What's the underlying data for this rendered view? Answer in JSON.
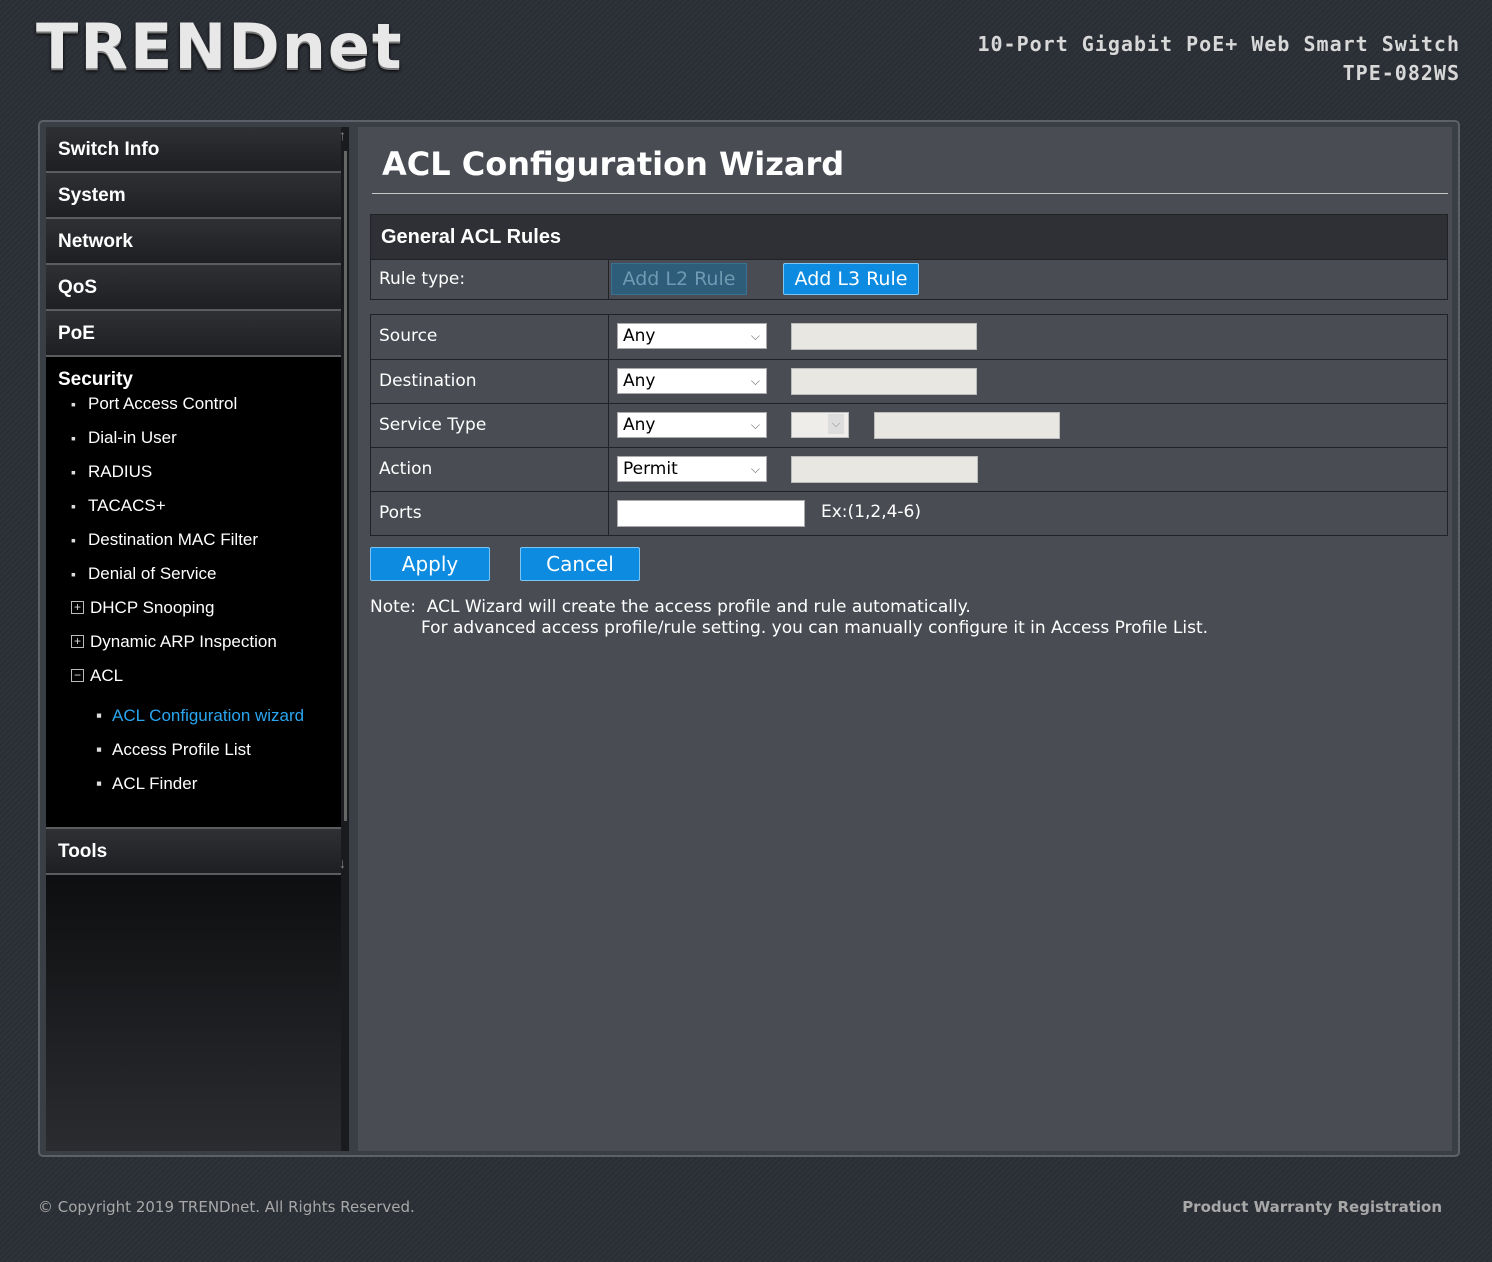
{
  "header": {
    "logo": "TRENDnet",
    "product_line": "10-Port Gigabit PoE+ Web Smart Switch",
    "model": "TPE-082WS"
  },
  "sidebar": {
    "items": [
      {
        "label": "Switch Info"
      },
      {
        "label": "System"
      },
      {
        "label": "Network"
      },
      {
        "label": "QoS"
      },
      {
        "label": "PoE"
      }
    ],
    "security": {
      "label": "Security",
      "children": [
        {
          "label": "Port Access Control"
        },
        {
          "label": "Dial-in User"
        },
        {
          "label": "RADIUS"
        },
        {
          "label": "TACACS+"
        },
        {
          "label": "Destination MAC Filter"
        },
        {
          "label": "Denial of Service"
        },
        {
          "label": "DHCP Snooping"
        },
        {
          "label": "Dynamic ARP Inspection"
        },
        {
          "label": "ACL"
        }
      ],
      "acl_children": [
        {
          "label": "ACL Configuration wizard"
        },
        {
          "label": "Access Profile List"
        },
        {
          "label": "ACL Finder"
        }
      ]
    },
    "tools": "Tools"
  },
  "main": {
    "title": "ACL Configuration Wizard",
    "section_title": "General ACL Rules",
    "rule_type_label": "Rule type:",
    "add_l2": "Add L2 Rule",
    "add_l3": "Add L3 Rule",
    "rows": {
      "source": {
        "label": "Source",
        "value": "Any"
      },
      "destination": {
        "label": "Destination",
        "value": "Any"
      },
      "service": {
        "label": "Service Type",
        "value": "Any"
      },
      "action": {
        "label": "Action",
        "value": "Permit"
      },
      "ports": {
        "label": "Ports",
        "value": "",
        "hint": "Ex:(1,2,4-6)"
      }
    },
    "apply": "Apply",
    "cancel": "Cancel",
    "note_line1": "Note:  ACL Wizard will create the access profile and rule automatically.",
    "note_line2": "For advanced access profile/rule setting. you can manually configure it in Access Profile List."
  },
  "footer": {
    "copyright": "© Copyright 2019 TRENDnet. All Rights Reserved.",
    "warranty": "Product Warranty Registration"
  },
  "colors": {
    "accent": "#0c8be0",
    "active_link": "#2aa6f0"
  }
}
